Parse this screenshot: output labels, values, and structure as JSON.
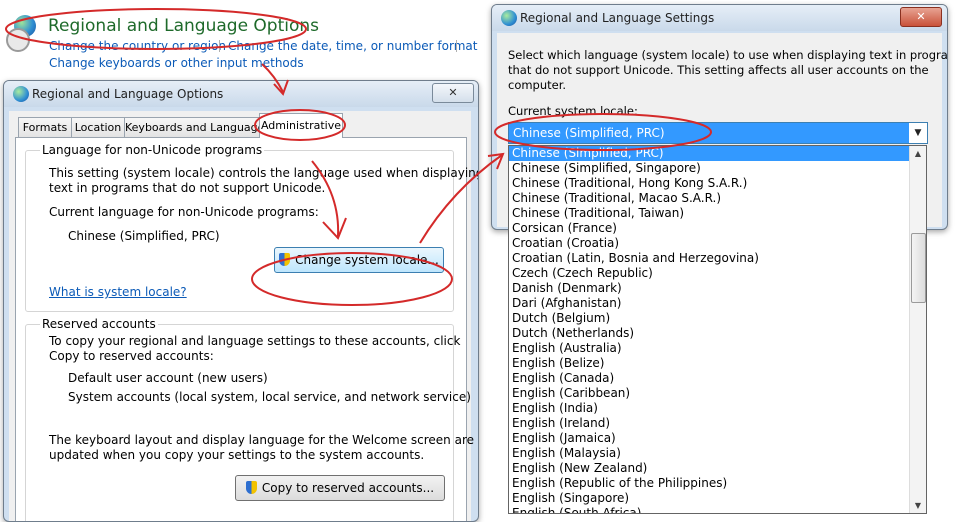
{
  "control_panel": {
    "title": "Regional and Language Options",
    "links": [
      "Change the country or region",
      "Change the date, time, or number format",
      "Change keyboards or other input methods"
    ]
  },
  "dialog1": {
    "title": "Regional and Language Options",
    "close": "✕",
    "tabs": [
      "Formats",
      "Location",
      "Keyboards and Languages",
      "Administrative"
    ],
    "non_unicode": {
      "label": "Language for non-Unicode programs",
      "desc1": "This setting (system locale) controls the language used when displaying",
      "desc2": "text in programs that do not support Unicode.",
      "current_label": "Current language for non-Unicode programs:",
      "current_value": "Chinese (Simplified, PRC)",
      "button": "Change system locale...",
      "link": "What is system locale?"
    },
    "reserved": {
      "label": "Reserved accounts",
      "desc1": "To copy your regional and language settings to these accounts, click",
      "desc2": "Copy to reserved accounts:",
      "item1": "Default user account (new users)",
      "item2": "System accounts (local system, local service, and network service)",
      "desc3": "The keyboard layout and display language for the Welcome screen are",
      "desc4": "updated when you copy your settings to the system accounts.",
      "button": "Copy to reserved accounts..."
    }
  },
  "dialog2": {
    "title": "Regional and Language Settings",
    "close": "✕",
    "desc1": "Select which language (system locale) to use when displaying text in programs",
    "desc2": "that do not support Unicode. This setting affects all user accounts on the",
    "desc3": "computer.",
    "current_label": "Current system locale:",
    "selected": "Chinese (Simplified, PRC)",
    "options": [
      "Chinese (Simplified, PRC)",
      "Chinese (Simplified, Singapore)",
      "Chinese (Traditional, Hong Kong S.A.R.)",
      "Chinese (Traditional, Macao S.A.R.)",
      "Chinese (Traditional, Taiwan)",
      "Corsican (France)",
      "Croatian (Croatia)",
      "Croatian (Latin, Bosnia and Herzegovina)",
      "Czech (Czech Republic)",
      "Danish (Denmark)",
      "Dari (Afghanistan)",
      "Dutch (Belgium)",
      "Dutch (Netherlands)",
      "English (Australia)",
      "English (Belize)",
      "English (Canada)",
      "English (Caribbean)",
      "English (India)",
      "English (Ireland)",
      "English (Jamaica)",
      "English (Malaysia)",
      "English (New Zealand)",
      "English (Republic of the Philippines)",
      "English (Singapore)",
      "English (South Africa)"
    ]
  },
  "annotation_color": "#d42a2a"
}
